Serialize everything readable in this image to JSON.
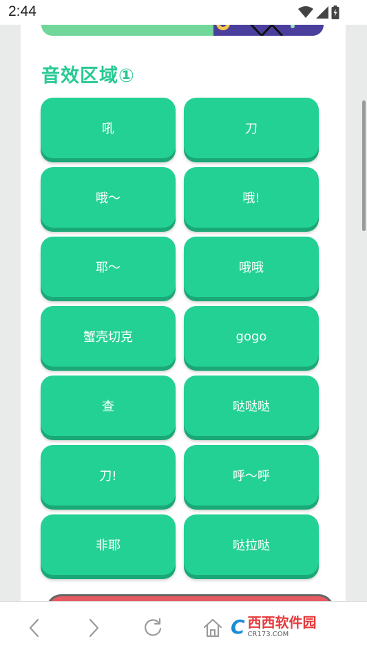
{
  "status_bar": {
    "time": "2:44"
  },
  "section": {
    "title": "音效区域①"
  },
  "sound_buttons": [
    {
      "label": "吼"
    },
    {
      "label": "刀"
    },
    {
      "label": "哦～"
    },
    {
      "label": "哦!"
    },
    {
      "label": "耶～"
    },
    {
      "label": "哦哦"
    },
    {
      "label": "蟹壳切克"
    },
    {
      "label": "gogo"
    },
    {
      "label": "查"
    },
    {
      "label": "哒哒哒"
    },
    {
      "label": "刀!"
    },
    {
      "label": "呼～呼"
    },
    {
      "label": "非耶"
    },
    {
      "label": "哒拉哒"
    }
  ],
  "watermark": {
    "logo_text": "C",
    "name": "西西软件园",
    "domain": "CR173.COM"
  },
  "colors": {
    "accent": "#24d194",
    "title": "#27c994",
    "next_section": "#e85a62"
  },
  "icons": {
    "wifi": "wifi-icon",
    "signal": "signal-icon",
    "battery": "battery-icon",
    "back": "back-icon",
    "forward": "forward-icon",
    "reload": "reload-icon",
    "home": "home-icon"
  }
}
